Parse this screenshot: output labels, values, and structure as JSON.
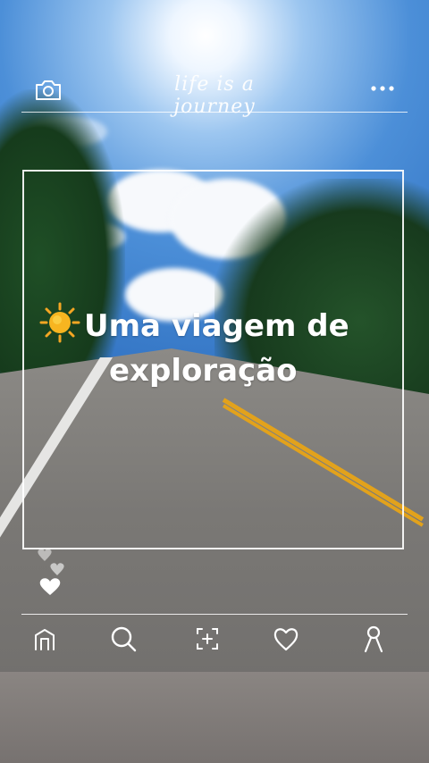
{
  "header": {
    "tagline": "life is a journey",
    "left_icon": "camera-icon",
    "right_icon": "more-dots-icon"
  },
  "headline": {
    "emoji_icon": "sun-icon",
    "line1": "Uma viagem de",
    "line2": "exploração"
  },
  "reactions": {
    "icon": "hearts-icon"
  },
  "nav": {
    "items": [
      {
        "icon": "home-icon"
      },
      {
        "icon": "search-icon"
      },
      {
        "icon": "add-post-icon"
      },
      {
        "icon": "heart-icon"
      },
      {
        "icon": "profile-icon"
      }
    ]
  },
  "colors": {
    "overlay": "#ffffff",
    "sun": "#f5a623",
    "road_line": "#e2a21c"
  }
}
